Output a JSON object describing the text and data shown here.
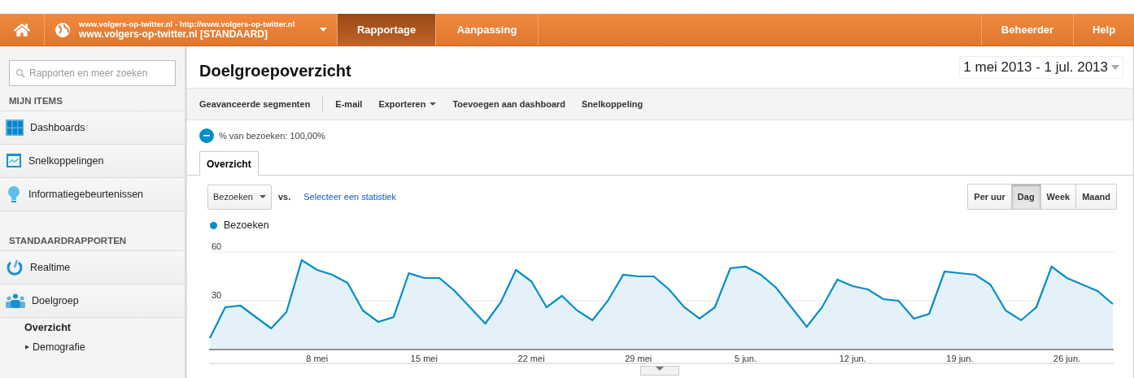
{
  "top_bar": {
    "property_url": "www.volgers-op-twitter.nl - http://www.volgers-op-twitter.nl",
    "property_name": "www.volgers-op-twitter.nl [STANDAARD]",
    "tabs": [
      {
        "label": "Rapportage",
        "selected": true
      },
      {
        "label": "Aanpassing",
        "selected": false
      }
    ],
    "right_links": [
      "Beheerder",
      "Help"
    ]
  },
  "sidebar": {
    "search": {
      "placeholder": "Rapporten en meer zoeken"
    },
    "sections": [
      {
        "title": "MIJN ITEMS",
        "items": [
          {
            "label": "Dashboards"
          },
          {
            "label": "Snelkoppelingen"
          },
          {
            "label": "Informatiegebeurtenissen"
          }
        ]
      },
      {
        "title": "STANDAARDRAPPORTEN",
        "items": [
          {
            "label": "Realtime"
          },
          {
            "label": "Doelgroep",
            "children": [
              {
                "label": "Overzicht",
                "kind": "leaf",
                "selected": true
              },
              {
                "label": "Demografie",
                "kind": "group",
                "selected": false,
                "expanded": false
              }
            ]
          }
        ]
      }
    ]
  },
  "main": {
    "title": "Doelgroepoverzicht",
    "date_range": "1 mei 2013 - 1 jul. 2013",
    "toolbar": [
      {
        "label": "Geavanceerde segmenten",
        "dropdown": false
      },
      {
        "label": "E-mail",
        "dropdown": false
      },
      {
        "label": "Exporteren",
        "dropdown": true
      },
      {
        "label": "Toevoegen aan dashboard",
        "dropdown": false
      },
      {
        "label": "Snelkoppeling",
        "dropdown": false
      }
    ],
    "segment": "% van bezoeken: 100,00%",
    "tabs": [
      {
        "label": "Overzicht",
        "selected": true
      }
    ],
    "metric_select": "Bezoeken",
    "vs_label": "vs.",
    "compare_link": "Selecteer een statistiek",
    "granularity": [
      {
        "label": "Per uur",
        "selected": false
      },
      {
        "label": "Dag",
        "selected": true
      },
      {
        "label": "Week",
        "selected": false
      },
      {
        "label": "Maand",
        "selected": false
      }
    ],
    "chart": {
      "chart_data": {
        "type": "area",
        "ylim": [
          0,
          60
        ],
        "yticks": [
          30,
          60
        ],
        "categories": [
          null,
          null,
          null,
          null,
          null,
          null,
          null,
          "8 mei",
          null,
          null,
          null,
          null,
          null,
          null,
          "15 mei",
          null,
          null,
          null,
          null,
          null,
          null,
          "22 mei",
          null,
          null,
          null,
          null,
          null,
          null,
          "29 mei",
          null,
          null,
          null,
          null,
          null,
          null,
          "5 jun.",
          null,
          null,
          null,
          null,
          null,
          null,
          "12 jun.",
          null,
          null,
          null,
          null,
          null,
          null,
          "19 jun.",
          null,
          null,
          null,
          null,
          null,
          null,
          "26 jun.",
          null,
          null,
          null
        ],
        "series": [
          {
            "name": "Bezoeken",
            "color": "#058dc7",
            "values": [
              7,
              26,
              27,
              20,
              13,
              23,
              55,
              49,
              46,
              41,
              24,
              17,
              20,
              47,
              44,
              44,
              36,
              26,
              16,
              29,
              49,
              42,
              26,
              33,
              24,
              18,
              30,
              46,
              45,
              45,
              37,
              26,
              19,
              26,
              50,
              51,
              46,
              38,
              26,
              14,
              26,
              43,
              39,
              37,
              31,
              30,
              19,
              22,
              48,
              47,
              46,
              40,
              24,
              18,
              26,
              51,
              44,
              40,
              36,
              28
            ]
          }
        ]
      }
    }
  }
}
